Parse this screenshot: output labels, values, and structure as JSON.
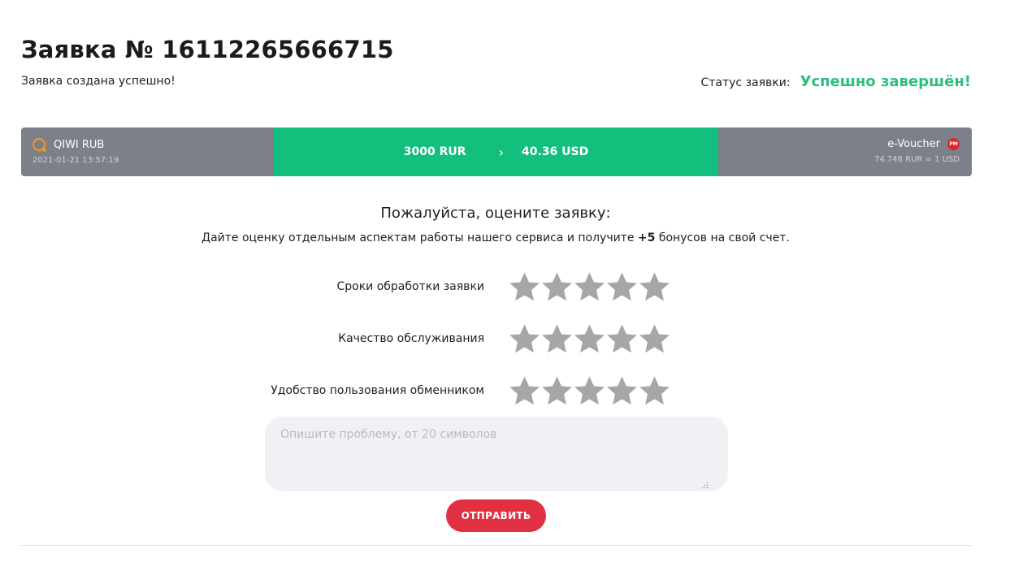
{
  "header": {
    "title": "Заявка № 16112265666715",
    "subtitle": "Заявка создана успешно!",
    "status_label": "Статус заявки:",
    "status_value": "Успешно завершён!",
    "status_color": "#2ebd7f"
  },
  "exchange": {
    "from": {
      "name": "QIWI RUB",
      "date": "2021-01-21 13:57:19",
      "icon": "qiwi-icon"
    },
    "amount_from": "3000 RUR",
    "arrow": "›",
    "amount_to": "40.36 USD",
    "to": {
      "name": "e-Voucher",
      "rate": "74.748 RUR = 1 USD",
      "icon": "perfect-money-icon",
      "icon_text": "PM"
    },
    "accent_color": "#12bf7c",
    "bar_color": "#7d8089"
  },
  "rating": {
    "title": "Пожалуйста, оцените заявку:",
    "desc_before": "Дайте оценку отдельным аспектам работы нашего сервиса и получите ",
    "desc_bonus": "+5",
    "desc_after": " бонусов на свой счет.",
    "criteria": [
      {
        "label": "Сроки обработки заявки",
        "stars": 0,
        "max": 5
      },
      {
        "label": "Качество обслуживания",
        "stars": 0,
        "max": 5
      },
      {
        "label": "Удобство пользования обменником",
        "stars": 0,
        "max": 5
      }
    ],
    "star_color": "#a6a6a6"
  },
  "comment": {
    "placeholder": "Опишите проблему, от 20 символов",
    "value": ""
  },
  "submit_label": "ОТПРАВИТЬ",
  "submit_color": "#e23043"
}
